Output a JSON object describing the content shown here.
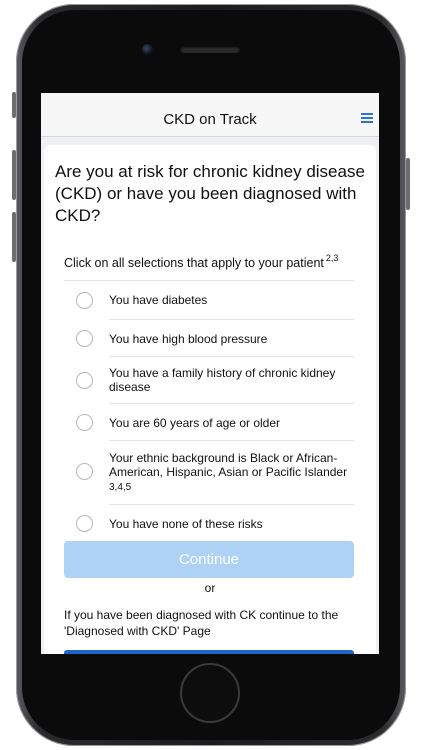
{
  "app": {
    "title": "CKD on Track"
  },
  "header": {
    "menu_icon": "hamburger-menu-icon"
  },
  "question": {
    "title": "Are you at risk for chronic kidney disease (CKD) or have you been diagnosed with CKD?"
  },
  "instruction": {
    "text": "Click on all selections that apply to your patient",
    "references": "2,3"
  },
  "options": [
    {
      "label": "You have diabetes",
      "note": ""
    },
    {
      "label": "You have high blood pressure",
      "note": ""
    },
    {
      "label": "You have a family history of chronic kidney disease",
      "note": ""
    },
    {
      "label": "You are 60 years of age or older",
      "note": ""
    },
    {
      "label": "Your ethnic background is Black or African-American, Hispanic, Asian or Pacific Islander",
      "note": "3,4,5"
    },
    {
      "label": "You have none of these risks",
      "note": ""
    }
  ],
  "actions": {
    "continue_label": "Continue",
    "or_label": "or",
    "diagnosed_text": "If you have been diagnosed with CK continue to the 'Diagnosed with CKD' Page"
  },
  "colors": {
    "accent": "#2a73d9",
    "continue_disabled": "#aed2f6",
    "primary_button": "#1e67c9"
  }
}
